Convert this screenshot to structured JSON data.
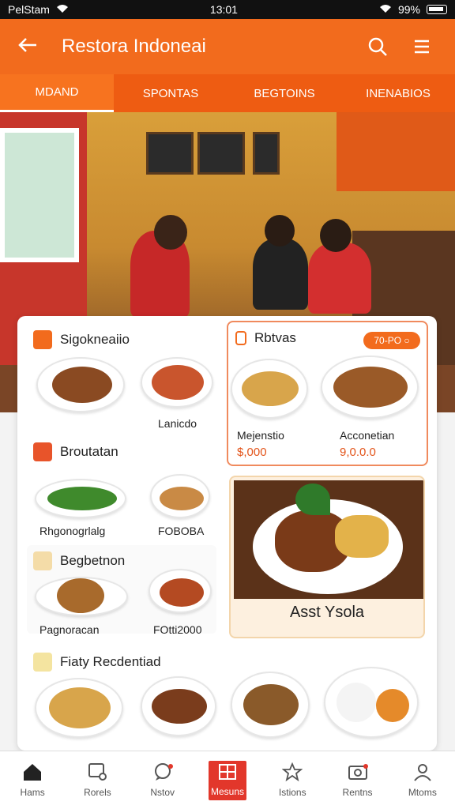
{
  "status": {
    "carrier": "PelStam",
    "time": "13:01",
    "battery": "99%"
  },
  "app_bar": {
    "title": "Restora Indoneai",
    "back_icon": "back-arrow-icon",
    "search_icon": "search-icon",
    "menu_icon": "menu-icon"
  },
  "tabs": [
    {
      "label": "MDAND",
      "active": true
    },
    {
      "label": "SPONTAS",
      "active": false
    },
    {
      "label": "BEGTOINS",
      "active": false
    },
    {
      "label": "INENABIOS",
      "active": false
    }
  ],
  "sections": {
    "s1": {
      "title": "Sigokneaiio",
      "icon": "plane-icon"
    },
    "s2": {
      "title": "Broutatan",
      "icon": "category-icon"
    },
    "s3": {
      "title": "Begbetnon",
      "icon": "category-icon"
    },
    "s4": {
      "title": "Fiaty Recdentiad",
      "icon": "category-icon"
    }
  },
  "dishes": {
    "d1_label": "Lanicdo",
    "d2_label": "Rhgonogrlalg",
    "d3_label": "FOBOBA",
    "d4_label": "Pagnoracan",
    "d5_label": "FOtti2000"
  },
  "highlight": {
    "title": "Rbtvas",
    "badge": "70-PO ○",
    "left_name": "Mejenstio",
    "left_price": "$,000",
    "right_name": "Acconetian",
    "right_price": "9,0.0.0"
  },
  "feature": {
    "caption": "Asst Ysola"
  },
  "bottom_nav": [
    {
      "label": "Hams",
      "icon": "home-icon",
      "active": false
    },
    {
      "label": "Rorels",
      "icon": "orders-icon",
      "active": false
    },
    {
      "label": "Nstov",
      "icon": "chat-icon",
      "active": false
    },
    {
      "label": "Mesuns",
      "icon": "menu-book-icon",
      "active": true
    },
    {
      "label": "Istions",
      "icon": "star-icon",
      "active": false
    },
    {
      "label": "Rentns",
      "icon": "camera-icon",
      "active": false
    },
    {
      "label": "Mtoms",
      "icon": "profile-icon",
      "active": false
    }
  ],
  "colors": {
    "primary": "#f26b1d",
    "accent": "#e2372b"
  }
}
